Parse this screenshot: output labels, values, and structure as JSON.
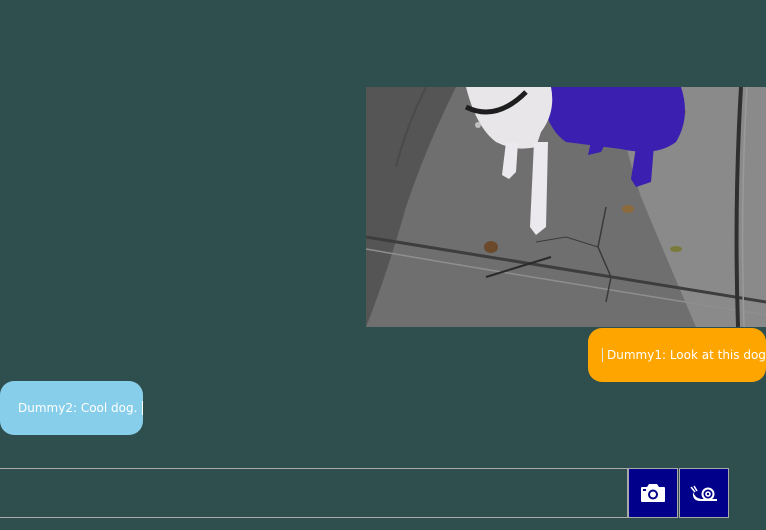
{
  "chat": {
    "messages": [
      {
        "sender": "Dummy1",
        "text": "Dummy1: Look at this dog",
        "side": "right",
        "color": "#ffa500"
      },
      {
        "sender": "Dummy2",
        "text": "Dummy2: Cool dog.",
        "side": "left",
        "color": "#87ceeb"
      }
    ],
    "image_message": {
      "icon": "dog-photo"
    }
  },
  "composer": {
    "value": "",
    "placeholder": ""
  },
  "toolbar": {
    "camera_icon": "camera-icon",
    "snail_icon": "snail-icon"
  },
  "theme": {
    "background": "#2f4f4f",
    "button_bg": "#00008b",
    "border": "#a9a9a9"
  }
}
